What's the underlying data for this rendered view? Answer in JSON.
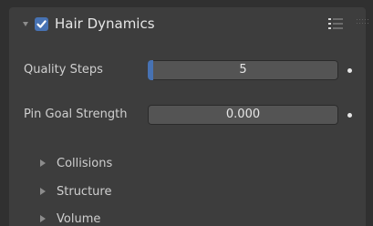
{
  "panel": {
    "title": "Hair Dynamics",
    "enabled": true,
    "icons": {
      "collapse": "disclosure-triangle-down-icon",
      "checkbox": "checkbox-checked-icon",
      "presets": "preset-list-icon",
      "drag": "drag-handle-icon"
    }
  },
  "properties": [
    {
      "label": "Quality Steps",
      "value": "5",
      "slider_fraction": 0.03
    },
    {
      "label": "Pin Goal Strength",
      "value": "0.000",
      "slider_fraction": 0
    }
  ],
  "subpanels": [
    {
      "label": "Collisions",
      "expanded": false
    },
    {
      "label": "Structure",
      "expanded": false
    },
    {
      "label": "Volume",
      "expanded": false
    }
  ],
  "colors": {
    "background": "#303030",
    "panel": "#3d3d3d",
    "field": "#545454",
    "accent": "#4772b3",
    "text": "#e6e6e6"
  }
}
